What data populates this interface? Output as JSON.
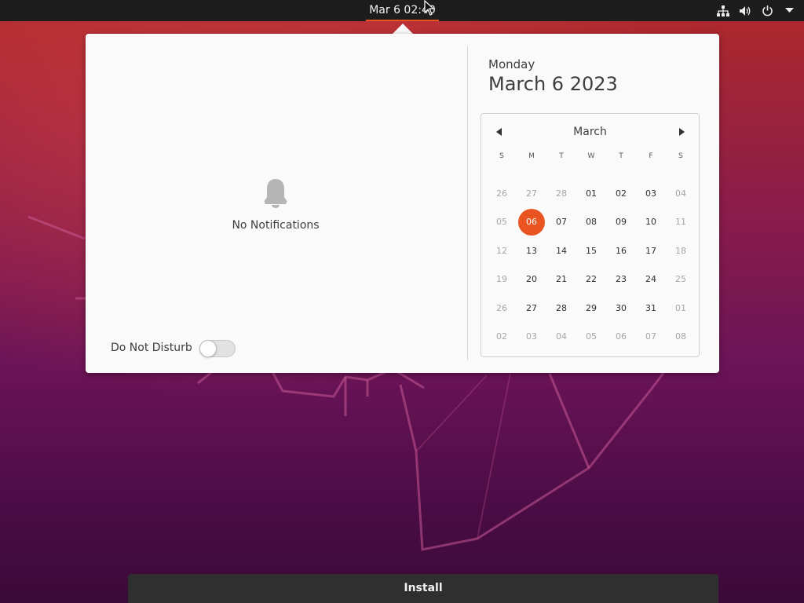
{
  "topbar": {
    "clock": "Mar 6  02:40",
    "icons": [
      "network-icon",
      "volume-icon",
      "power-icon",
      "dropdown-arrow-icon"
    ]
  },
  "notifications": {
    "empty_label": "No Notifications",
    "dnd_label": "Do Not Disturb",
    "dnd_enabled": false
  },
  "date": {
    "weekday": "Monday",
    "full": "March 6 2023"
  },
  "calendar": {
    "month": "March",
    "weekdays": [
      "S",
      "M",
      "T",
      "W",
      "T",
      "F",
      "S"
    ],
    "weeks": [
      [
        "26",
        "27",
        "28",
        "01",
        "02",
        "03",
        "04"
      ],
      [
        "05",
        "06",
        "07",
        "08",
        "09",
        "10",
        "11"
      ],
      [
        "12",
        "13",
        "14",
        "15",
        "16",
        "17",
        "18"
      ],
      [
        "19",
        "20",
        "21",
        "22",
        "23",
        "24",
        "25"
      ],
      [
        "26",
        "27",
        "28",
        "29",
        "30",
        "31",
        "01"
      ],
      [
        "02",
        "03",
        "04",
        "05",
        "06",
        "07",
        "08"
      ]
    ],
    "today": "06"
  },
  "install": {
    "label": "Install"
  },
  "colors": {
    "accent": "#e95420",
    "topbar": "#1d1d1d",
    "popup": "#fafafa"
  }
}
